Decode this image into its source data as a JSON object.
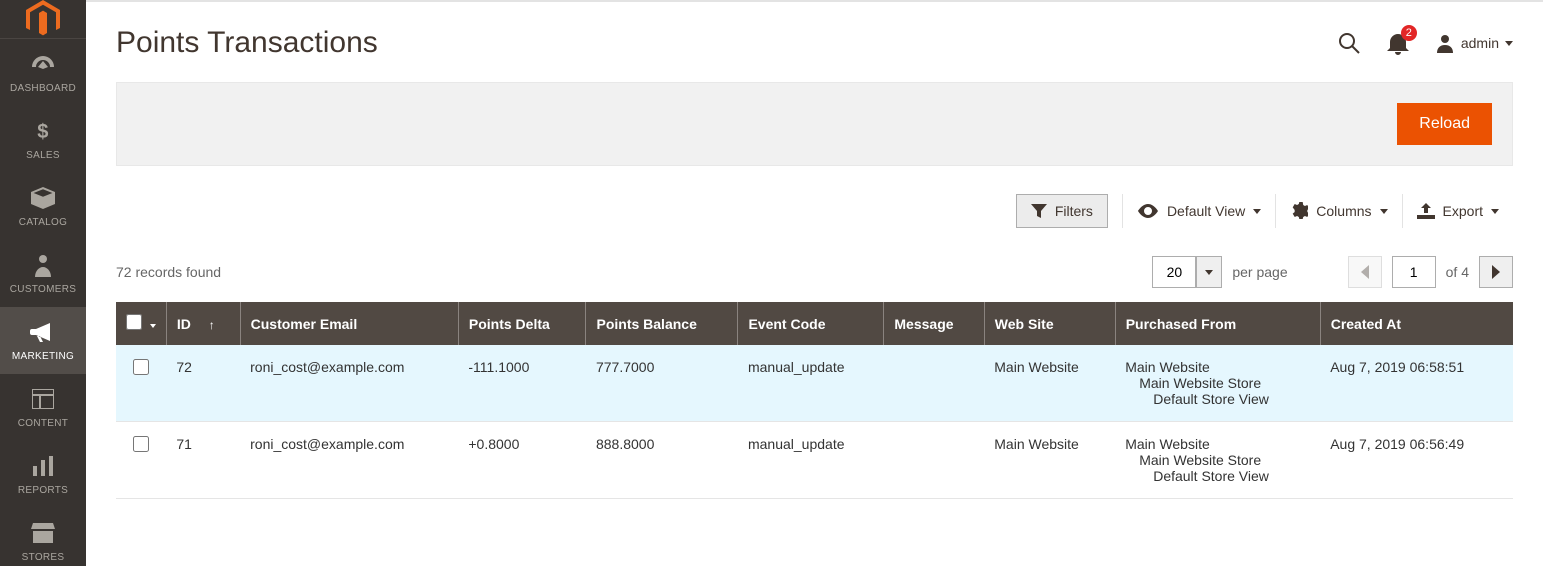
{
  "sidebar": {
    "items": [
      {
        "label": "DASHBOARD"
      },
      {
        "label": "SALES"
      },
      {
        "label": "CATALOG"
      },
      {
        "label": "CUSTOMERS"
      },
      {
        "label": "MARKETING"
      },
      {
        "label": "CONTENT"
      },
      {
        "label": "REPORTS"
      },
      {
        "label": "STORES"
      }
    ]
  },
  "header": {
    "title": "Points Transactions",
    "notifications_count": "2",
    "user_label": "admin"
  },
  "actions": {
    "reload_label": "Reload"
  },
  "toolbar": {
    "filters_label": "Filters",
    "default_view_label": "Default View",
    "columns_label": "Columns",
    "export_label": "Export"
  },
  "grid": {
    "records_found": "72 records found",
    "page_size": "20",
    "per_page_label": "per page",
    "current_page": "1",
    "of_label": "of 4",
    "columns": {
      "id": "ID",
      "email": "Customer Email",
      "delta": "Points Delta",
      "balance": "Points Balance",
      "event": "Event Code",
      "message": "Message",
      "website": "Web Site",
      "purchased_from": "Purchased From",
      "created_at": "Created At"
    },
    "rows": [
      {
        "id": "72",
        "email": "roni_cost@example.com",
        "delta": "-111.1000",
        "balance": "777.7000",
        "event": "manual_update",
        "message": "",
        "website": "Main Website",
        "purchased_from_l1": "Main Website",
        "purchased_from_l2": "Main Website Store",
        "purchased_from_l3": "Default Store View",
        "created_at": "Aug 7, 2019 06:58:51"
      },
      {
        "id": "71",
        "email": "roni_cost@example.com",
        "delta": "+0.8000",
        "balance": "888.8000",
        "event": "manual_update",
        "message": "",
        "website": "Main Website",
        "purchased_from_l1": "Main Website",
        "purchased_from_l2": "Main Website Store",
        "purchased_from_l3": "Default Store View",
        "created_at": "Aug 7, 2019 06:56:49"
      }
    ]
  }
}
